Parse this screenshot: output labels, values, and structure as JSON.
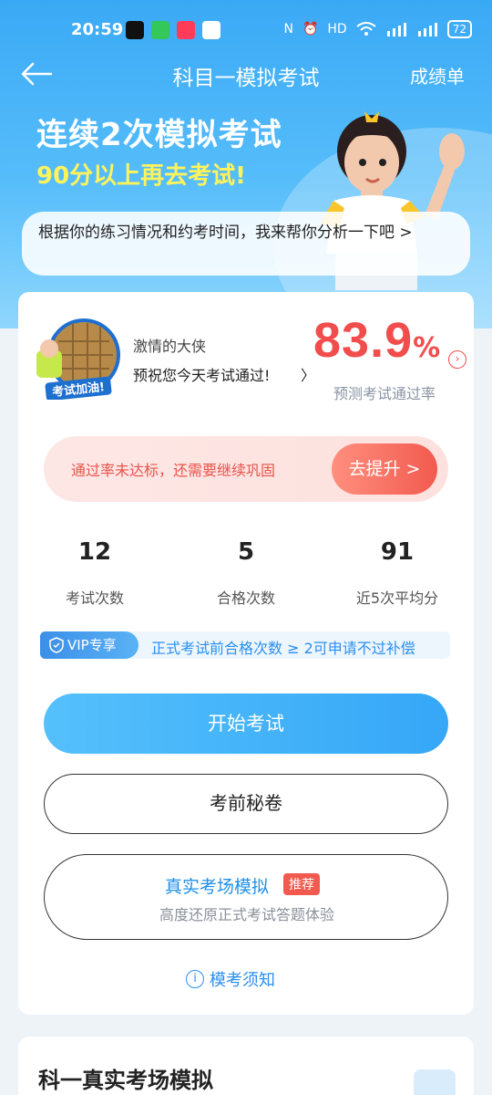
{
  "status_bar": {
    "time": "20:59",
    "battery": "72",
    "icons": [
      "nfc-icon",
      "alarm-icon",
      "hd-icon",
      "wifi-icon",
      "signal-5g-icon",
      "signal-5g-icon"
    ]
  },
  "nav": {
    "title": "科目一模拟考试",
    "action": "成绩单"
  },
  "hero": {
    "line1": "连续2次模拟考试",
    "line2": "90分以上再去考试!",
    "bubble": "根据你的练习情况和约考时间，我来帮你分析一下吧 >"
  },
  "profile": {
    "avatar_text": "考试加油!",
    "name": "激情的大侠",
    "wish": "预祝您今天考试通过!",
    "pass_rate": "83.9",
    "pass_rate_unit": "%",
    "pass_rate_label": "预测考试通过率"
  },
  "warning": {
    "text": "通过率未达标，还需要继续巩固",
    "button": "去提升 >"
  },
  "stats": [
    {
      "value": "12",
      "label": "考试次数"
    },
    {
      "value": "5",
      "label": "合格次数"
    },
    {
      "value": "91",
      "label": "近5次平均分"
    }
  ],
  "vip": {
    "tag": "VIP专享",
    "text": "正式考试前合格次数 ≥ 2可申请不过补偿"
  },
  "buttons": {
    "start": "开始考试",
    "secret": "考前秘卷",
    "real_title": "真实考场模拟",
    "real_badge": "推荐",
    "real_sub": "高度还原正式考试答题体验",
    "notice": "模考须知"
  },
  "second_card": {
    "title": "科一真实考场模拟"
  },
  "colors": {
    "primary": "#35a7f7",
    "danger": "#f24d4d",
    "highlight": "#fff35a"
  }
}
